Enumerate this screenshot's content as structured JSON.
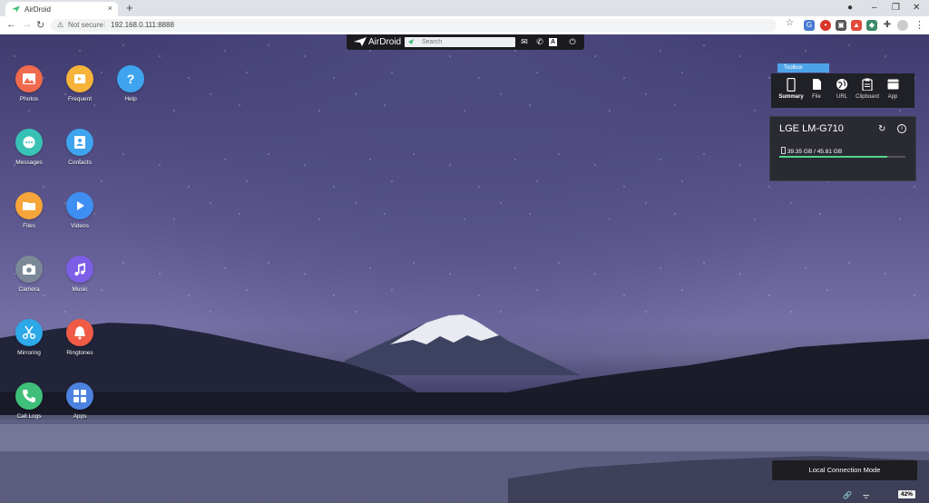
{
  "browser": {
    "tab_title": "AirDroid",
    "new_tab": "+",
    "security_label": "Not secure",
    "url": "192.168.0.111:8888"
  },
  "topbar": {
    "logo_text": "AirDroid",
    "search_placeholder": "Search"
  },
  "apps": [
    {
      "label": "Photos",
      "color": "#f06a4d",
      "icon": "photo-icon"
    },
    {
      "label": "Frequent",
      "color": "#f6b43a",
      "icon": "frequent-icon"
    },
    {
      "label": "Help",
      "color": "#3fa4ee",
      "icon": "help-icon"
    },
    {
      "label": "Messages",
      "color": "#38c2b6",
      "icon": "messages-icon"
    },
    {
      "label": "Contacts",
      "color": "#3fa4ee",
      "icon": "contacts-icon"
    },
    {
      "label": "Files",
      "color": "#f6a53a",
      "icon": "folder-icon"
    },
    {
      "label": "Videos",
      "color": "#3f8ef2",
      "icon": "video-icon"
    },
    {
      "label": "Camera",
      "color": "#7a8898",
      "icon": "camera-icon"
    },
    {
      "label": "Music",
      "color": "#7c5fe6",
      "icon": "music-icon"
    },
    {
      "label": "Mirroring",
      "color": "#2da8e8",
      "icon": "mirroring-icon"
    },
    {
      "label": "Ringtones",
      "color": "#ef5b45",
      "icon": "bell-icon"
    },
    {
      "label": "Call Logs",
      "color": "#3fbf7a",
      "icon": "phone-icon"
    },
    {
      "label": "Apps",
      "color": "#4c82e0",
      "icon": "apps-icon"
    }
  ],
  "toolbox": {
    "tab_label": "Toolbox",
    "items": [
      "Summary",
      "File",
      "URL",
      "Clipboard",
      "App"
    ]
  },
  "device": {
    "name": "LGE LM-G710",
    "storage": "39.35 GB / 45.81 GB",
    "storage_used_fraction": 0.859
  },
  "status": {
    "connection_mode": "Local Connection Mode",
    "battery": "42%"
  }
}
